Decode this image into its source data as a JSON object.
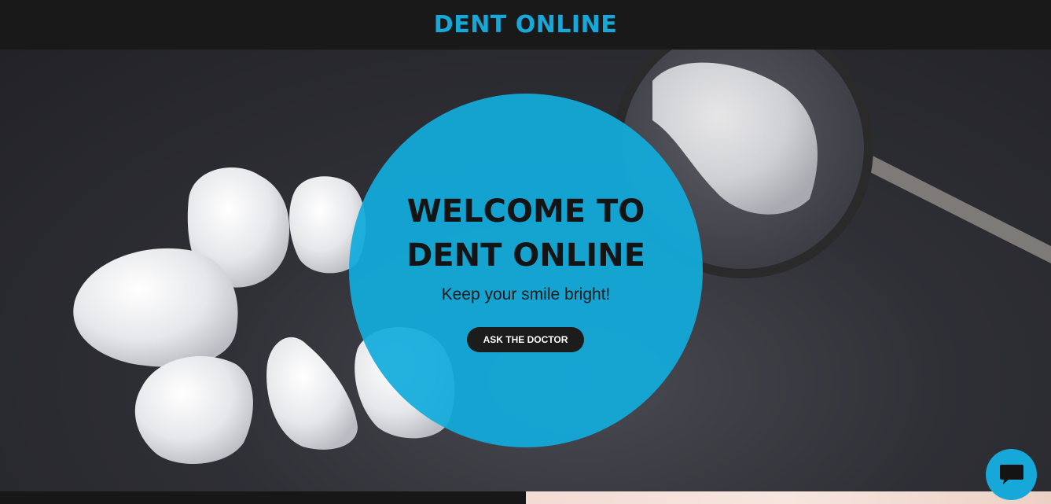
{
  "header": {
    "brand": "DENT ONLINE"
  },
  "hero": {
    "headline_line1": "WELCOME TO",
    "headline_line2": "DENT ONLINE",
    "tagline": "Keep your smile bright!",
    "cta_label": "ASK THE DOCTOR"
  },
  "chat": {
    "icon": "chat-bubble-icon"
  },
  "colors": {
    "accent": "#16a8d8",
    "header_bg": "#19191a",
    "button_bg": "#1c1c1c"
  }
}
